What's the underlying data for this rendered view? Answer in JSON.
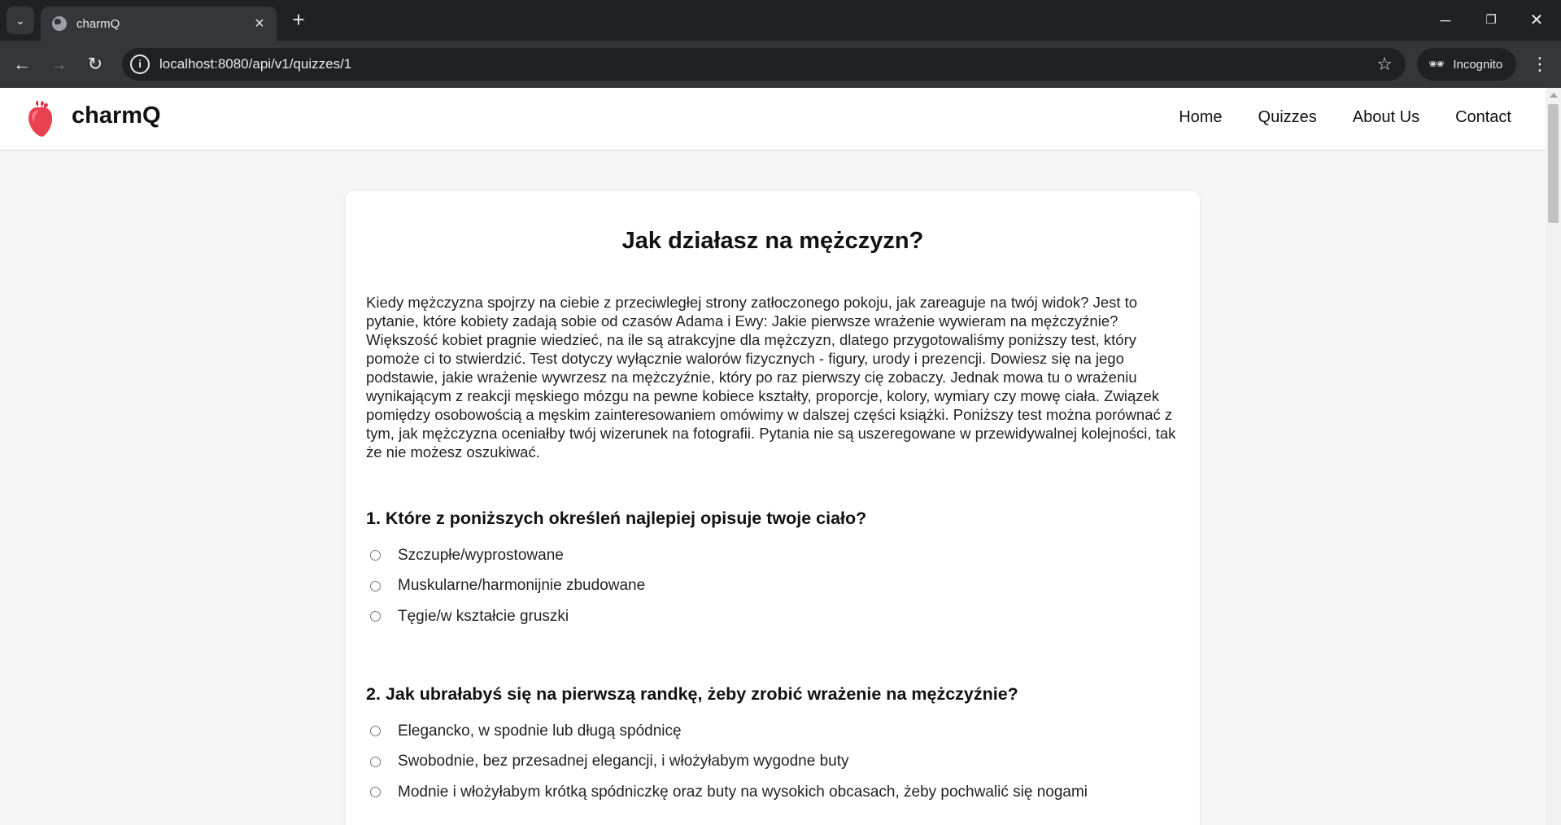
{
  "browser": {
    "tab_title": "charmQ",
    "new_tab_symbol": "+",
    "url": "localhost:8080/api/v1/quizzes/1",
    "profile_label": "Incognito"
  },
  "header": {
    "brand": "charmQ",
    "nav": [
      "Home",
      "Quizzes",
      "About Us",
      "Contact"
    ]
  },
  "quiz": {
    "title": "Jak działasz na mężczyzn?",
    "description": "Kiedy mężczyzna spojrzy na ciebie z przeciwległej strony zatłoczonego pokoju, jak zareaguje na twój widok? Jest to pytanie, które kobiety zadają sobie od czasów Adama i Ewy: Jakie pierwsze wrażenie wywieram na mężczyźnie? Większość kobiet pragnie wiedzieć, na ile są atrakcyjne dla mężczyzn, dlatego przygotowaliśmy poniższy test, który pomoże ci to stwierdzić. Test dotyczy wyłącznie walorów fizycznych - figury, urody i prezencji. Dowiesz się na jego podstawie, jakie wrażenie wywrzesz na mężczyźnie, który po raz pierwszy cię zobaczy. Jednak mowa tu o wrażeniu wynikającym z reakcji męskiego mózgu na pewne kobiece kształty, proporcje, kolory, wymiary czy mowę ciała. Związek pomiędzy osobowością a męskim zainteresowaniem omówimy w dalszej części książki. Poniższy test można porównać z tym, jak mężczyzna oceniałby twój wizerunek na fotografii. Pytania nie są uszeregowane w przewidywalnej kolejności, tak że nie możesz oszukiwać.",
    "questions": [
      {
        "text": "1. Które z poniższych określeń najlepiej opisuje twoje ciało?",
        "options": [
          "Szczupłe/wyprostowane",
          "Muskularne/harmonijnie zbudowane",
          "Tęgie/w kształcie gruszki"
        ]
      },
      {
        "text": "2. Jak ubrałabyś się na pierwszą randkę, żeby zrobić wrażenie na mężczyźnie?",
        "options": [
          "Elegancko, w spodnie lub długą spódnicę",
          "Swobodnie, bez przesadnej elegancji, i włożyłabym wygodne buty",
          "Modnie i włożyłabym krótką spódniczkę oraz buty na wysokich obcasach, żeby pochwalić się nogami"
        ]
      }
    ]
  },
  "colors": {
    "logo_heart": "#e8414f",
    "page_bg": "#f5f5f5",
    "chrome_dark": "#202124",
    "chrome_toolbar": "#35363a"
  }
}
